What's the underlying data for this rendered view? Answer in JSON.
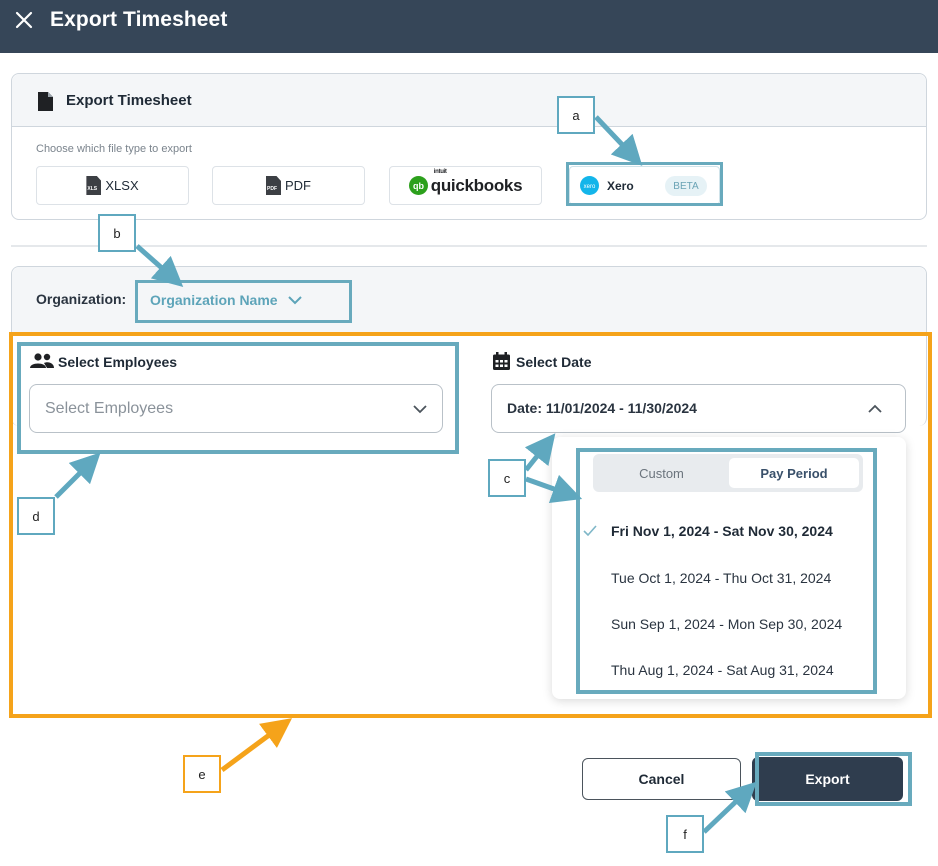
{
  "header": {
    "title": "Export Timesheet"
  },
  "export_card": {
    "title": "Export Timesheet",
    "hint": "Choose which file type to export",
    "file_types": [
      {
        "label": "XLSX",
        "icon_text": "XLS"
      },
      {
        "label": "PDF",
        "icon_text": "PDF"
      },
      {
        "brand_small": "intuit",
        "brand": "quickbooks"
      },
      {
        "label": "Xero",
        "icon_text": "xero",
        "badge": "BETA"
      }
    ]
  },
  "organization": {
    "label": "Organization:",
    "value": "Organization Name"
  },
  "employees": {
    "label": "Select Employees",
    "placeholder": "Select Employees"
  },
  "date": {
    "label": "Select Date",
    "value": "Date: 11/01/2024 - 11/30/2024",
    "tabs": [
      "Custom",
      "Pay Period"
    ],
    "active_tab": "Pay Period",
    "options": [
      {
        "label": "Fri Nov 1, 2024 - Sat Nov 30, 2024",
        "selected": true
      },
      {
        "label": "Tue Oct 1, 2024 - Thu Oct 31, 2024",
        "selected": false
      },
      {
        "label": "Sun Sep 1, 2024 - Mon Sep 30, 2024",
        "selected": false
      },
      {
        "label": "Thu Aug 1, 2024 - Sat Aug 31, 2024",
        "selected": false
      }
    ]
  },
  "buttons": {
    "cancel": "Cancel",
    "export": "Export"
  },
  "annotations": {
    "a": "a",
    "b": "b",
    "c": "c",
    "d": "d",
    "e": "e",
    "f": "f"
  },
  "colors": {
    "header": "#364658",
    "accent": "#68aabd",
    "orange": "#f5a31a",
    "xero": "#13b5ea",
    "quickbooks": "#2ca01c"
  }
}
